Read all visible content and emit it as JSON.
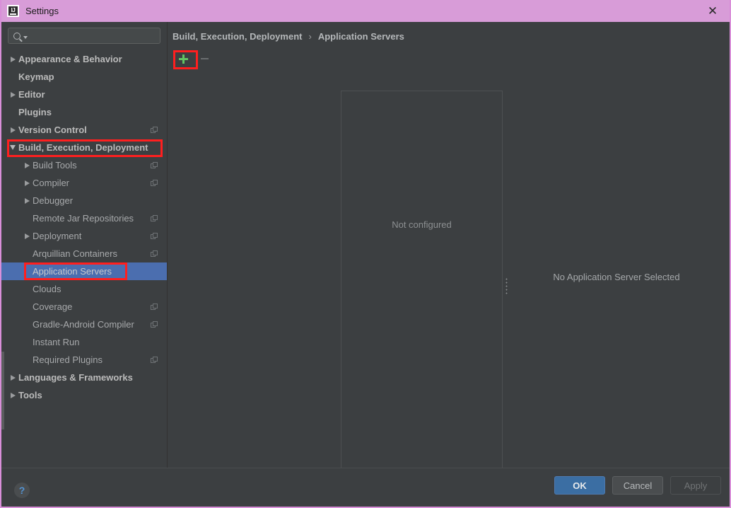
{
  "window": {
    "title": "Settings",
    "app_icon": "intellij-idea-icon",
    "close_label": "✕",
    "border_color": "#d98fd9",
    "titlebar_color": "#d89cd8"
  },
  "search": {
    "value": "",
    "placeholder": "",
    "icon": "search-icon",
    "caret_icon": "chevron-down-icon"
  },
  "sidebar": {
    "items": [
      {
        "label": "Appearance & Behavior",
        "level": 0,
        "twisty": "right",
        "badge": false,
        "selected": false
      },
      {
        "label": "Keymap",
        "level": 0,
        "twisty": "none",
        "badge": false,
        "selected": false
      },
      {
        "label": "Editor",
        "level": 0,
        "twisty": "right",
        "badge": false,
        "selected": false
      },
      {
        "label": "Plugins",
        "level": 0,
        "twisty": "none",
        "badge": false,
        "selected": false
      },
      {
        "label": "Version Control",
        "level": 0,
        "twisty": "right",
        "badge": true,
        "selected": false
      },
      {
        "label": "Build, Execution, Deployment",
        "level": 0,
        "twisty": "down",
        "badge": false,
        "selected": false
      },
      {
        "label": "Build Tools",
        "level": 1,
        "twisty": "right",
        "badge": true,
        "selected": false
      },
      {
        "label": "Compiler",
        "level": 1,
        "twisty": "right",
        "badge": true,
        "selected": false
      },
      {
        "label": "Debugger",
        "level": 1,
        "twisty": "right",
        "badge": false,
        "selected": false
      },
      {
        "label": "Remote Jar Repositories",
        "level": 1,
        "twisty": "none",
        "badge": true,
        "selected": false
      },
      {
        "label": "Deployment",
        "level": 1,
        "twisty": "right",
        "badge": true,
        "selected": false
      },
      {
        "label": "Arquillian Containers",
        "level": 1,
        "twisty": "none",
        "badge": true,
        "selected": false
      },
      {
        "label": "Application Servers",
        "level": 1,
        "twisty": "none",
        "badge": false,
        "selected": true
      },
      {
        "label": "Clouds",
        "level": 1,
        "twisty": "none",
        "badge": false,
        "selected": false
      },
      {
        "label": "Coverage",
        "level": 1,
        "twisty": "none",
        "badge": true,
        "selected": false
      },
      {
        "label": "Gradle-Android Compiler",
        "level": 1,
        "twisty": "none",
        "badge": true,
        "selected": false
      },
      {
        "label": "Instant Run",
        "level": 1,
        "twisty": "none",
        "badge": false,
        "selected": false
      },
      {
        "label": "Required Plugins",
        "level": 1,
        "twisty": "none",
        "badge": true,
        "selected": false
      },
      {
        "label": "Languages & Frameworks",
        "level": 0,
        "twisty": "right",
        "badge": false,
        "selected": false
      },
      {
        "label": "Tools",
        "level": 0,
        "twisty": "right",
        "badge": false,
        "selected": false
      }
    ],
    "selection_color": "#4b6eaf"
  },
  "content": {
    "breadcrumb": {
      "parent": "Build, Execution, Deployment",
      "separator": "›",
      "current": "Application Servers"
    },
    "toolbar": {
      "add_label": "+",
      "add_icon": "plus-icon",
      "add_color": "#62c462",
      "remove_label": "−",
      "remove_icon": "minus-icon",
      "remove_enabled": false
    },
    "list_panel": {
      "empty_text": "Not configured"
    },
    "detail_panel": {
      "empty_text": "No Application Server Selected"
    },
    "splitter_icon": "splitter-handle-icon"
  },
  "footer": {
    "help_label": "?",
    "help_icon": "help-icon",
    "buttons": [
      {
        "label": "OK",
        "state": "primary"
      },
      {
        "label": "Cancel",
        "state": "normal"
      },
      {
        "label": "Apply",
        "state": "disabled"
      }
    ]
  },
  "annotations": {
    "color": "#ff1f1f",
    "boxes": [
      {
        "target": "add-button"
      },
      {
        "target": "sidebar-item-build-execution-deployment"
      },
      {
        "target": "sidebar-item-application-servers"
      }
    ]
  }
}
